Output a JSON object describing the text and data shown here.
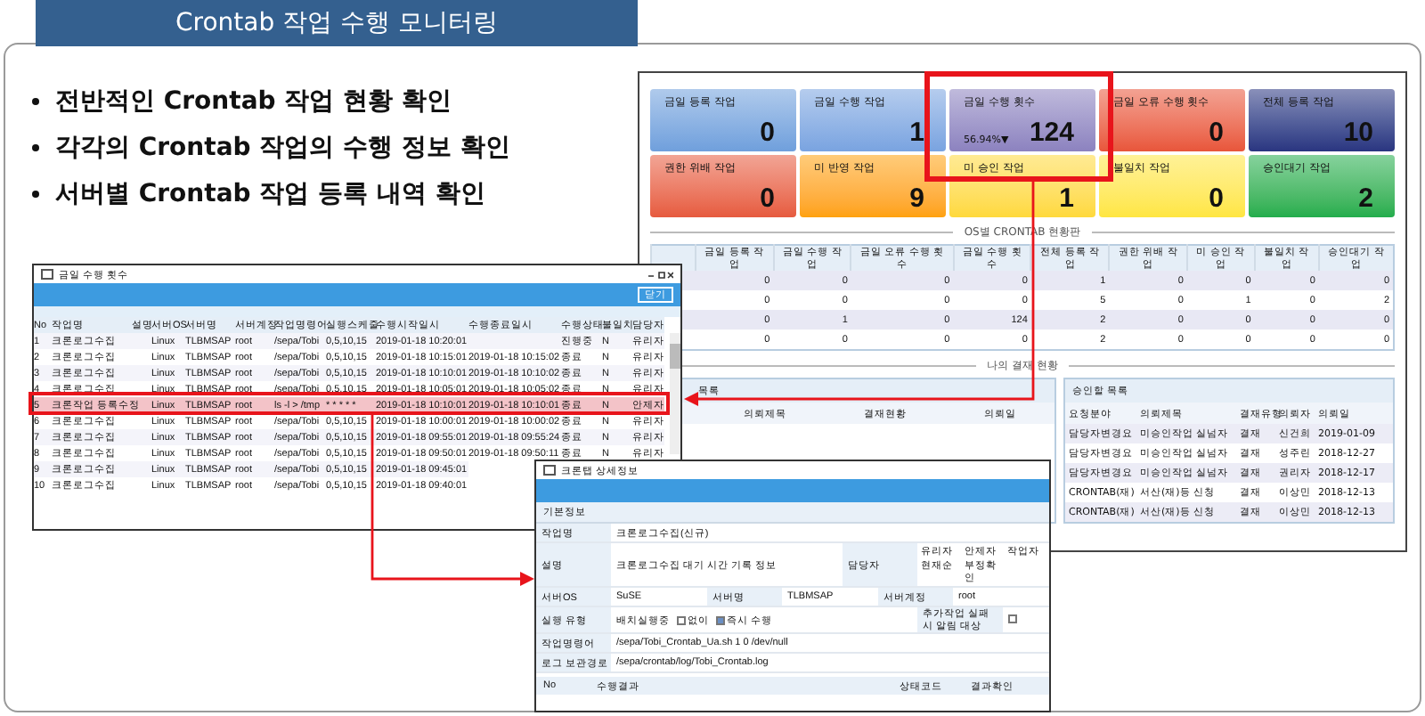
{
  "slide_title": "Crontab 작업 수행 모니터링",
  "bullets": [
    "전반적인 Crontab 작업 현황 확인",
    "각각의 Crontab 작업의 수행 정보 확인",
    "서버별 Crontab 작업 등록 내역 확인"
  ],
  "dashboard": {
    "tiles": [
      {
        "label": "금일 등록 작업",
        "value": "0",
        "color": "#6f9fdc"
      },
      {
        "label": "금일 수행 작업",
        "value": "1",
        "color": "#79a3e0"
      },
      {
        "label": "금일 수행 횟수",
        "value": "124",
        "sub": "56.94%▼",
        "color": "#8c82bf"
      },
      {
        "label": "금일 오류 수행 횟수",
        "value": "0",
        "color": "#e8553a"
      },
      {
        "label": "전체 등록 작업",
        "value": "10",
        "color": "#2a3580"
      },
      {
        "label": "권한 위배 작업",
        "value": "0",
        "color": "#e65a3e"
      },
      {
        "label": "미 반영 작업",
        "value": "9",
        "color": "#ffa10a"
      },
      {
        "label": "미 승인 작업",
        "value": "1",
        "color": "#ffd93a"
      },
      {
        "label": "불일치 작업",
        "value": "0",
        "color": "#ffe640"
      },
      {
        "label": "승인대기 작업",
        "value": "2",
        "color": "#22ad4c"
      }
    ],
    "os_section_title": "OS별 CRONTAB 현황판",
    "os_table": {
      "columns": [
        "금일 등록 작업",
        "금일 수행 작업",
        "금일 오류 수행 횟수",
        "금일 수행 횟수",
        "전체 등록 작업",
        "권한 위배 작업",
        "미 승인 작업",
        "불일치 작업",
        "승인대기 작업"
      ],
      "rows": [
        [
          "0",
          "0",
          "0",
          "0",
          "1",
          "0",
          "0",
          "0",
          "0"
        ],
        [
          "0",
          "0",
          "0",
          "0",
          "5",
          "0",
          "1",
          "0",
          "2"
        ],
        [
          "0",
          "1",
          "0",
          "124",
          "2",
          "0",
          "0",
          "0",
          "0"
        ],
        [
          "0",
          "0",
          "0",
          "0",
          "2",
          "0",
          "0",
          "0",
          "0"
        ]
      ]
    },
    "approval_section_title": "나의 결재 현황",
    "my_requests": {
      "title": "목록",
      "columns": [
        "의뢰제목",
        "결재현황",
        "의뢰일"
      ]
    },
    "to_approve": {
      "title": "승인할 목록",
      "columns": [
        "요청분야",
        "의뢰제목",
        "결재유형",
        "의뢰자",
        "의뢰일"
      ],
      "rows": [
        [
          "담당자변경요",
          "미승인작업 실넘자",
          "결재",
          "신건희",
          "2019-01-09"
        ],
        [
          "담당자변경요",
          "미승인작업 실넘자",
          "결재",
          "성주린",
          "2018-12-27"
        ],
        [
          "담당자변경요",
          "미승인작업 실넘자",
          "결재",
          "권리자",
          "2018-12-17"
        ],
        [
          "CRONTAB(재)",
          "서산(재)등 신청",
          "결재",
          "이상민",
          "2018-12-13"
        ],
        [
          "CRONTAB(재)",
          "서산(재)등 신청",
          "결재",
          "이상민",
          "2018-12-13"
        ]
      ]
    }
  },
  "runs_window": {
    "title": "금일 수행 횟수",
    "close_button": "닫기",
    "columns": [
      "No",
      "작업명",
      "설명",
      "서버OS",
      "서버명",
      "서버계정",
      "작업명령어",
      "실행스케줄",
      "수행시작일시",
      "수행종료일시",
      "수행상태",
      "불일치",
      "담당자"
    ],
    "rows": [
      {
        "selected": false,
        "cells": [
          "1",
          "크론로그수집",
          null,
          "Linux",
          "TLBMSAP",
          "root",
          "/sepa/Tobi",
          "0,5,10,15",
          "2019-01-18 10:20:01",
          null,
          "진행중",
          "N",
          "유리자"
        ]
      },
      {
        "selected": false,
        "cells": [
          "2",
          "크론로그수집",
          null,
          "Linux",
          "TLBMSAP",
          "root",
          "/sepa/Tobi",
          "0,5,10,15",
          "2019-01-18 10:15:01",
          "2019-01-18 10:15:02",
          "종료",
          "N",
          "유리자"
        ]
      },
      {
        "selected": false,
        "cells": [
          "3",
          "크론로그수집",
          null,
          "Linux",
          "TLBMSAP",
          "root",
          "/sepa/Tobi",
          "0,5,10,15",
          "2019-01-18 10:10:01",
          "2019-01-18 10:10:02",
          "종료",
          "N",
          "유리자"
        ]
      },
      {
        "selected": false,
        "cells": [
          "4",
          "크론로그수집",
          null,
          "Linux",
          "TLBMSAP",
          "root",
          "/sepa/Tobi",
          "0,5,10,15",
          "2019-01-18 10:05:01",
          "2019-01-18 10:05:02",
          "종료",
          "N",
          "유리자"
        ]
      },
      {
        "selected": true,
        "cells": [
          "5",
          "크론작업 등록수정",
          null,
          "Linux",
          "TLBMSAP",
          "root",
          "ls -l > /tmp",
          "* * * * *",
          "2019-01-18 10:10:01",
          "2019-01-18 10:10:01",
          "종료",
          "N",
          "안제자"
        ]
      },
      {
        "selected": false,
        "cells": [
          "6",
          "크론로그수집",
          null,
          "Linux",
          "TLBMSAP",
          "root",
          "/sepa/Tobi",
          "0,5,10,15",
          "2019-01-18 10:00:01",
          "2019-01-18 10:00:02",
          "종료",
          "N",
          "유리자"
        ]
      },
      {
        "selected": false,
        "cells": [
          "7",
          "크론로그수집",
          null,
          "Linux",
          "TLBMSAP",
          "root",
          "/sepa/Tobi",
          "0,5,10,15",
          "2019-01-18 09:55:01",
          "2019-01-18 09:55:24",
          "종료",
          "N",
          "유리자"
        ]
      },
      {
        "selected": false,
        "cells": [
          "8",
          "크론로그수집",
          null,
          "Linux",
          "TLBMSAP",
          "root",
          "/sepa/Tobi",
          "0,5,10,15",
          "2019-01-18 09:50:01",
          "2019-01-18 09:50:11",
          "종료",
          "N",
          "유리자"
        ]
      },
      {
        "selected": false,
        "cells": [
          "9",
          "크론로그수집",
          null,
          "Linux",
          "TLBMSAP",
          "root",
          "/sepa/Tobi",
          "0,5,10,15",
          "2019-01-18 09:45:01"
        ]
      },
      {
        "selected": false,
        "cells": [
          "10",
          "크론로그수집",
          null,
          "Linux",
          "TLBMSAP",
          "root",
          "/sepa/Tobi",
          "0,5,10,15",
          "2019-01-18 09:40:01"
        ]
      }
    ]
  },
  "detail_window": {
    "title": "크론탭 상세정보",
    "section": "기본정보",
    "fields": [
      {
        "label": "작업명",
        "value": "크론로그수집(신규)"
      },
      {
        "label": "설명",
        "value": "크론로그수집 대기 시간 기록 정보"
      },
      {
        "label": "서버OS",
        "value": "SuSE"
      },
      {
        "label": "서버명",
        "value": "TLBMSAP"
      },
      {
        "label": "서버계정",
        "value": "root"
      },
      {
        "label": "작업명령어",
        "value": "/sepa/Tobi_Crontab_Ua.sh 1 0 /dev/null"
      },
      {
        "label": "로그 보관경로",
        "value": "/sepa/crontab/log/Tobi_Crontab.log"
      }
    ],
    "managers": {
      "label": "담당자",
      "names": [
        "유리자",
        "안제자",
        "작업자",
        "현재순",
        "부정확인"
      ]
    },
    "run_type": {
      "label": "실행 유형",
      "value": "배치실행중",
      "options": [
        {
          "label": "없이",
          "checked": false
        },
        {
          "label": "즉시 수행",
          "checked": true
        }
      ]
    },
    "notify": {
      "label": "추가작업 실패 시 알림 대상",
      "checked": false
    },
    "result_columns": [
      "No",
      "수행결과",
      "상태코드",
      "결과확인"
    ]
  }
}
